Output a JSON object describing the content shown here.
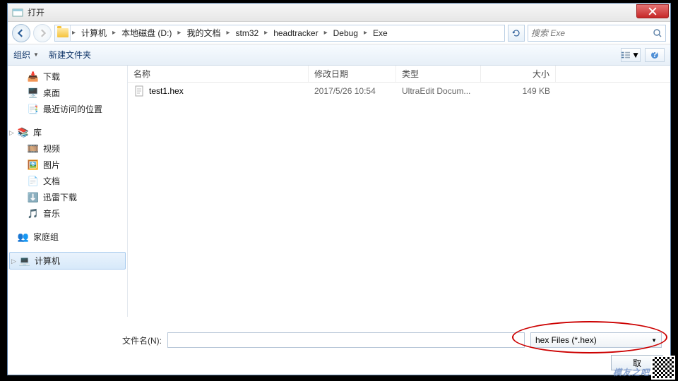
{
  "window": {
    "title": "打开"
  },
  "breadcrumb": [
    "计算机",
    "本地磁盘 (D:)",
    "我的文档",
    "stm32",
    "headtracker",
    "Debug",
    "Exe"
  ],
  "search": {
    "placeholder": "搜索 Exe"
  },
  "toolbar": {
    "organize": "组织",
    "new_folder": "新建文件夹"
  },
  "sidebar": {
    "downloads": "下载",
    "desktop": "桌面",
    "recent": "最近访问的位置",
    "library": "库",
    "video": "视频",
    "pictures": "图片",
    "documents": "文档",
    "xunlei": "迅雷下载",
    "music": "音乐",
    "homegroup": "家庭组",
    "computer": "计算机"
  },
  "columns": {
    "name": "名称",
    "date": "修改日期",
    "type": "类型",
    "size": "大小"
  },
  "files": [
    {
      "name": "test1.hex",
      "date": "2017/5/26 10:54",
      "type": "UltraEdit Docum...",
      "size": "149 KB"
    }
  ],
  "filename_label": "文件名(N):",
  "filename_value": "",
  "filter": "hex Files (*.hex)",
  "buttons": {
    "cancel_partial": "取"
  },
  "watermark": {
    "text": "模友之吧"
  }
}
